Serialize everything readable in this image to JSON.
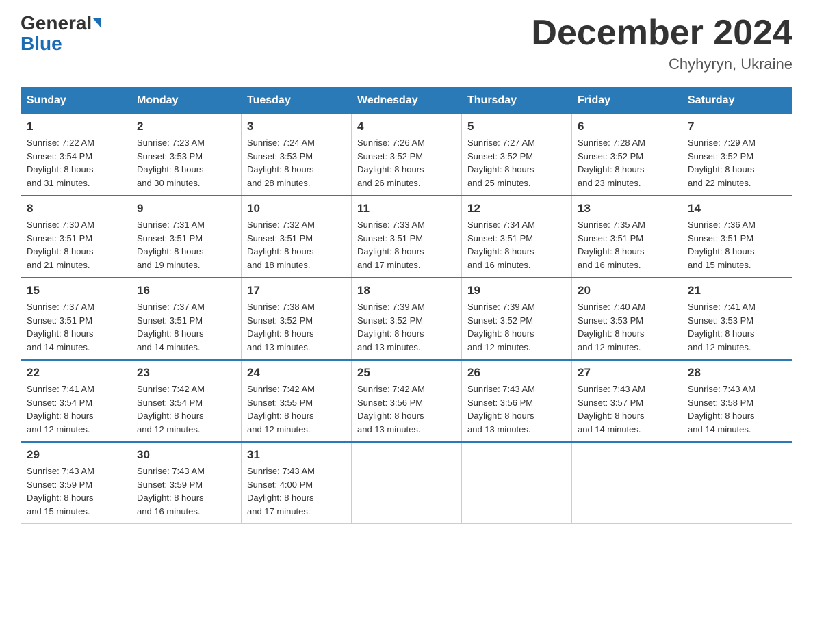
{
  "header": {
    "logo_general": "General",
    "logo_blue": "Blue",
    "title": "December 2024",
    "location": "Chyhyryn, Ukraine"
  },
  "days_of_week": [
    "Sunday",
    "Monday",
    "Tuesday",
    "Wednesday",
    "Thursday",
    "Friday",
    "Saturday"
  ],
  "weeks": [
    [
      {
        "day": "1",
        "sunrise": "7:22 AM",
        "sunset": "3:54 PM",
        "daylight": "8 hours and 31 minutes."
      },
      {
        "day": "2",
        "sunrise": "7:23 AM",
        "sunset": "3:53 PM",
        "daylight": "8 hours and 30 minutes."
      },
      {
        "day": "3",
        "sunrise": "7:24 AM",
        "sunset": "3:53 PM",
        "daylight": "8 hours and 28 minutes."
      },
      {
        "day": "4",
        "sunrise": "7:26 AM",
        "sunset": "3:52 PM",
        "daylight": "8 hours and 26 minutes."
      },
      {
        "day": "5",
        "sunrise": "7:27 AM",
        "sunset": "3:52 PM",
        "daylight": "8 hours and 25 minutes."
      },
      {
        "day": "6",
        "sunrise": "7:28 AM",
        "sunset": "3:52 PM",
        "daylight": "8 hours and 23 minutes."
      },
      {
        "day": "7",
        "sunrise": "7:29 AM",
        "sunset": "3:52 PM",
        "daylight": "8 hours and 22 minutes."
      }
    ],
    [
      {
        "day": "8",
        "sunrise": "7:30 AM",
        "sunset": "3:51 PM",
        "daylight": "8 hours and 21 minutes."
      },
      {
        "day": "9",
        "sunrise": "7:31 AM",
        "sunset": "3:51 PM",
        "daylight": "8 hours and 19 minutes."
      },
      {
        "day": "10",
        "sunrise": "7:32 AM",
        "sunset": "3:51 PM",
        "daylight": "8 hours and 18 minutes."
      },
      {
        "day": "11",
        "sunrise": "7:33 AM",
        "sunset": "3:51 PM",
        "daylight": "8 hours and 17 minutes."
      },
      {
        "day": "12",
        "sunrise": "7:34 AM",
        "sunset": "3:51 PM",
        "daylight": "8 hours and 16 minutes."
      },
      {
        "day": "13",
        "sunrise": "7:35 AM",
        "sunset": "3:51 PM",
        "daylight": "8 hours and 16 minutes."
      },
      {
        "day": "14",
        "sunrise": "7:36 AM",
        "sunset": "3:51 PM",
        "daylight": "8 hours and 15 minutes."
      }
    ],
    [
      {
        "day": "15",
        "sunrise": "7:37 AM",
        "sunset": "3:51 PM",
        "daylight": "8 hours and 14 minutes."
      },
      {
        "day": "16",
        "sunrise": "7:37 AM",
        "sunset": "3:51 PM",
        "daylight": "8 hours and 14 minutes."
      },
      {
        "day": "17",
        "sunrise": "7:38 AM",
        "sunset": "3:52 PM",
        "daylight": "8 hours and 13 minutes."
      },
      {
        "day": "18",
        "sunrise": "7:39 AM",
        "sunset": "3:52 PM",
        "daylight": "8 hours and 13 minutes."
      },
      {
        "day": "19",
        "sunrise": "7:39 AM",
        "sunset": "3:52 PM",
        "daylight": "8 hours and 12 minutes."
      },
      {
        "day": "20",
        "sunrise": "7:40 AM",
        "sunset": "3:53 PM",
        "daylight": "8 hours and 12 minutes."
      },
      {
        "day": "21",
        "sunrise": "7:41 AM",
        "sunset": "3:53 PM",
        "daylight": "8 hours and 12 minutes."
      }
    ],
    [
      {
        "day": "22",
        "sunrise": "7:41 AM",
        "sunset": "3:54 PM",
        "daylight": "8 hours and 12 minutes."
      },
      {
        "day": "23",
        "sunrise": "7:42 AM",
        "sunset": "3:54 PM",
        "daylight": "8 hours and 12 minutes."
      },
      {
        "day": "24",
        "sunrise": "7:42 AM",
        "sunset": "3:55 PM",
        "daylight": "8 hours and 12 minutes."
      },
      {
        "day": "25",
        "sunrise": "7:42 AM",
        "sunset": "3:56 PM",
        "daylight": "8 hours and 13 minutes."
      },
      {
        "day": "26",
        "sunrise": "7:43 AM",
        "sunset": "3:56 PM",
        "daylight": "8 hours and 13 minutes."
      },
      {
        "day": "27",
        "sunrise": "7:43 AM",
        "sunset": "3:57 PM",
        "daylight": "8 hours and 14 minutes."
      },
      {
        "day": "28",
        "sunrise": "7:43 AM",
        "sunset": "3:58 PM",
        "daylight": "8 hours and 14 minutes."
      }
    ],
    [
      {
        "day": "29",
        "sunrise": "7:43 AM",
        "sunset": "3:59 PM",
        "daylight": "8 hours and 15 minutes."
      },
      {
        "day": "30",
        "sunrise": "7:43 AM",
        "sunset": "3:59 PM",
        "daylight": "8 hours and 16 minutes."
      },
      {
        "day": "31",
        "sunrise": "7:43 AM",
        "sunset": "4:00 PM",
        "daylight": "8 hours and 17 minutes."
      },
      null,
      null,
      null,
      null
    ]
  ],
  "labels": {
    "sunrise": "Sunrise:",
    "sunset": "Sunset:",
    "daylight": "Daylight:"
  }
}
